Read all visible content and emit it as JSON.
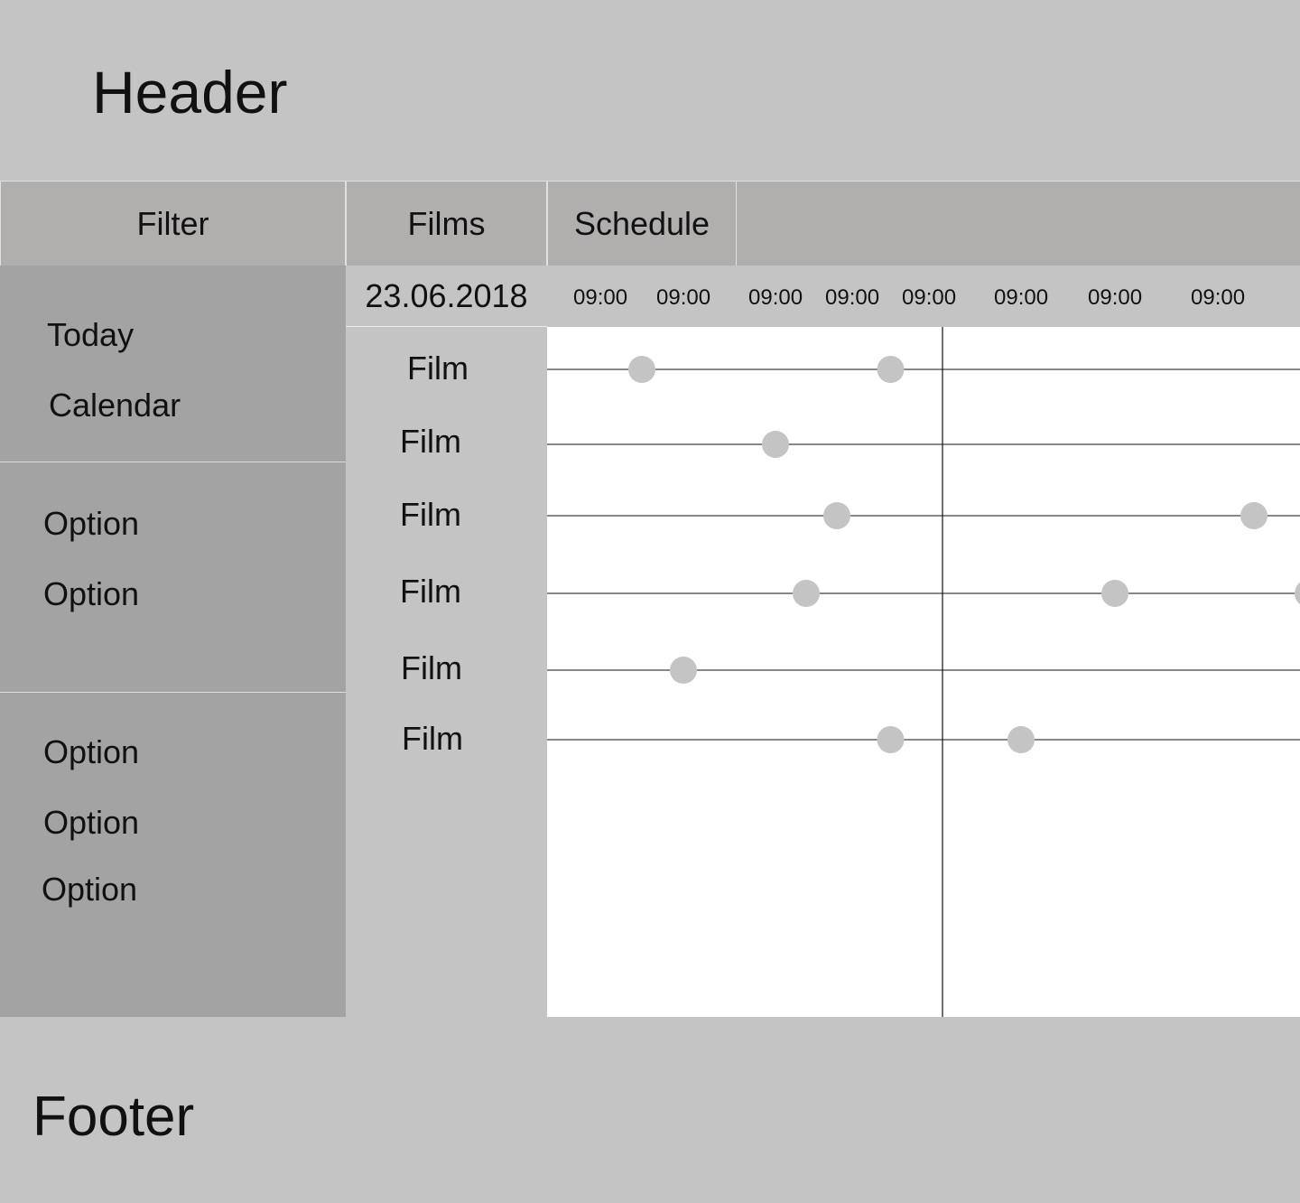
{
  "header": {
    "title": "Header"
  },
  "tabs": {
    "filter": "Filter",
    "films": "Films",
    "schedule": "Schedule"
  },
  "filter": {
    "group1": [
      "Today",
      "Calendar"
    ],
    "group2": [
      "Option",
      "Option"
    ],
    "group3": [
      "Option",
      "Option",
      "Option"
    ]
  },
  "schedule": {
    "date": "23.06.2018",
    "times": [
      "09:00",
      "09:00",
      "09:00",
      "09:00",
      "09:00",
      "09:00",
      "09:00",
      "09:00"
    ],
    "films": [
      "Film",
      "Film",
      "Film",
      "Film",
      "Film",
      "Film"
    ],
    "showings": [
      [
        0.5,
        3.5
      ],
      [
        2.0
      ],
      [
        2.8,
        7.4
      ],
      [
        2.4,
        6.0,
        8.0
      ],
      [
        1.0
      ],
      [
        3.5,
        5.0
      ]
    ]
  },
  "colors": {
    "dot": "#c4c4c4",
    "line": "#111111",
    "grid_bg": "#ffffff"
  },
  "footer": {
    "title": "Footer"
  }
}
